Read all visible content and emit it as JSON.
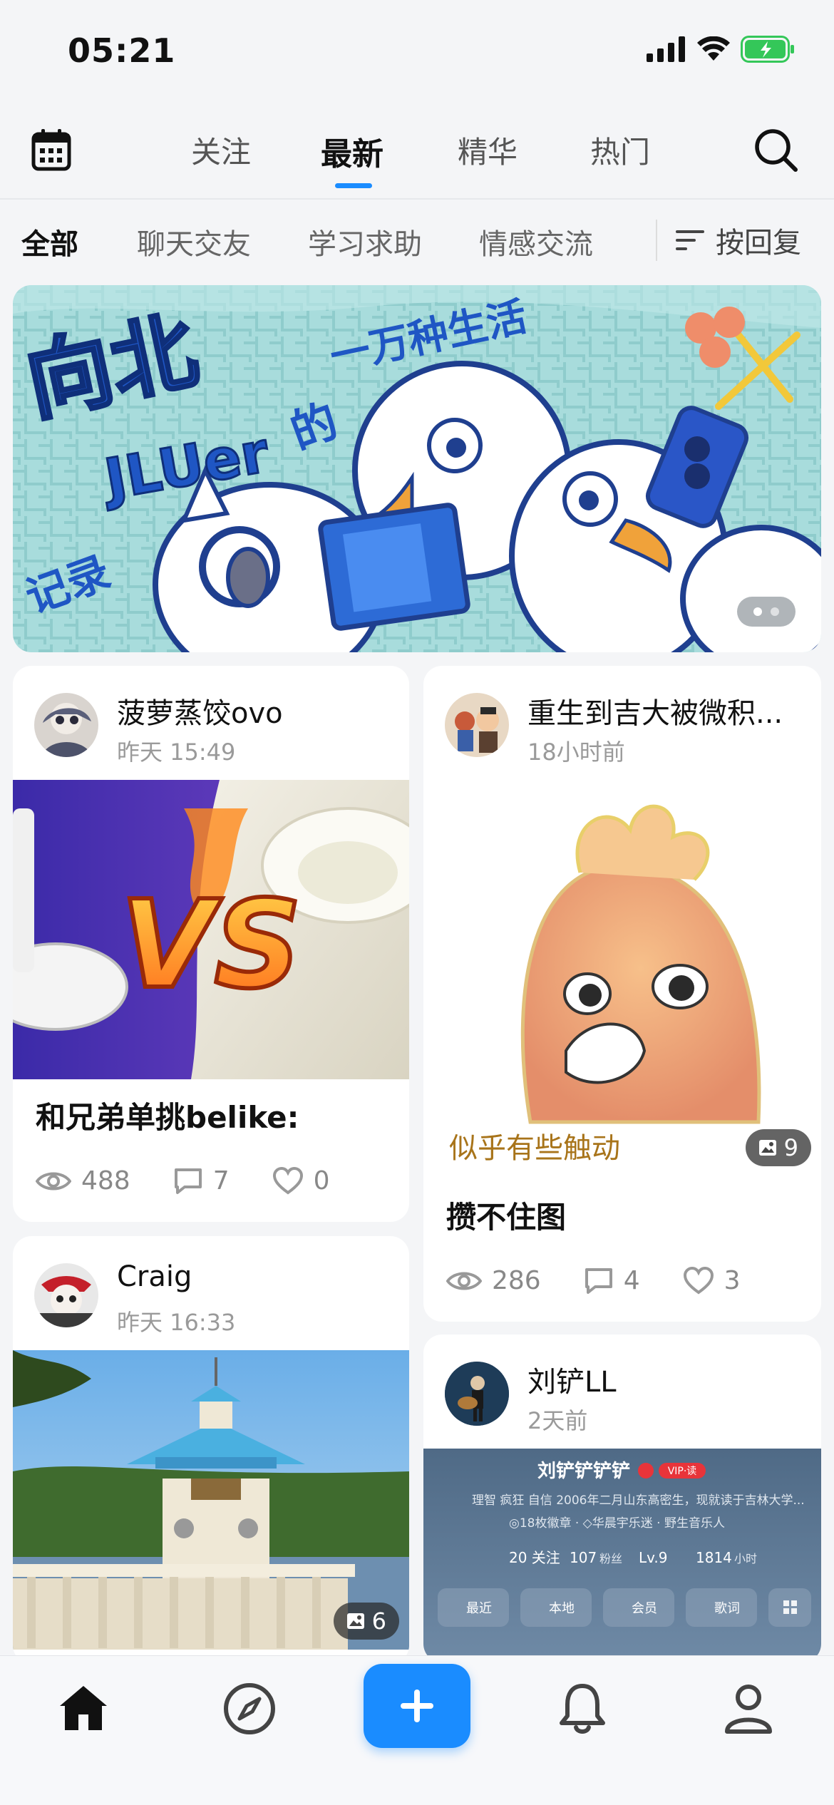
{
  "status_bar": {
    "time": "05:21"
  },
  "top_tabs": [
    {
      "label": "关注"
    },
    {
      "label": "最新",
      "active": true
    },
    {
      "label": "精华"
    },
    {
      "label": "热门"
    }
  ],
  "categories": [
    {
      "label": "全部",
      "active": true
    },
    {
      "label": "聊天交友"
    },
    {
      "label": "学习求助"
    },
    {
      "label": "情感交流"
    }
  ],
  "sort": {
    "label": "按回复"
  },
  "banner": {
    "text_main": "向北",
    "text_sub": "记录",
    "text_jluer": "JLUer",
    "text_de": "的",
    "text_life": "一万种生活"
  },
  "posts": [
    {
      "author": "菠萝蒸饺ovo",
      "time": "昨天 15:49",
      "title": "和兄弟单挑belike:",
      "views": "488",
      "comments": "7",
      "likes": "0",
      "image_text": "VS"
    },
    {
      "author": "重生到吉大被微积...",
      "time": "18小时前",
      "title": "攒不住图",
      "views": "286",
      "comments": "4",
      "likes": "3",
      "image_caption": "似乎有些触动",
      "image_count": "9"
    },
    {
      "author": "Craig",
      "time": "昨天 16:33",
      "image_count": "6"
    },
    {
      "author": "刘铲LL",
      "time": "2天前",
      "shot": {
        "name": "刘铲铲铲铲",
        "badge": "VIP·读",
        "bio": "理智 疯狂 自信 2006年二月山东高密生，现就读于吉林大学...",
        "line2": "◎18枚徽章 · ◇华晨宇乐迷 · 野生音乐人",
        "follow": "20 关注",
        "fans_num": "107",
        "fans_label": "粉丝",
        "level": "Lv.9",
        "hours_num": "1814",
        "hours_label": "小时",
        "buttons": [
          "最近",
          "本地",
          "会员",
          "歌词"
        ]
      }
    }
  ],
  "colors": {
    "accent": "#1a8cff",
    "battery": "#34c759",
    "background": "#f4f5f7"
  },
  "icons": [
    "calendar-icon",
    "search-icon",
    "sort-icon",
    "eye-icon",
    "comment-icon",
    "heart-icon",
    "image-icon",
    "home-icon",
    "compass-icon",
    "plus-icon",
    "bell-icon",
    "profile-icon"
  ]
}
